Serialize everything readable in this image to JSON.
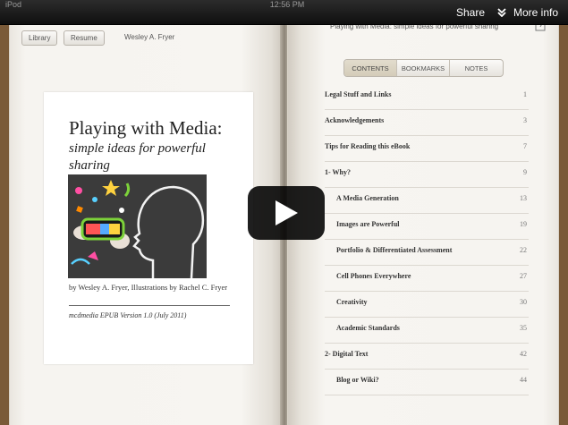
{
  "status_bar": {
    "device": "iPod",
    "time": "12:56 PM"
  },
  "player_overlay": {
    "share_label": "Share",
    "more_info_label": "More info"
  },
  "left_page": {
    "toolbar": {
      "library_label": "Library",
      "resume_label": "Resume",
      "author": "Wesley A. Fryer"
    },
    "cover": {
      "title": "Playing with Media:",
      "subtitle": "simple ideas for powerful sharing",
      "credits": "by Wesley A. Fryer, Illustrations by Rachel C. Fryer",
      "edition": "mcdmedia EPUB Version 1.0 (July 2011)"
    }
  },
  "right_page": {
    "header_title": "Playing with Media: simple ideas for powerful sharing",
    "tabs": [
      {
        "label": "CONTENTS",
        "active": true
      },
      {
        "label": "BOOKMARKS",
        "active": false
      },
      {
        "label": "NOTES",
        "active": false
      }
    ],
    "toc": [
      {
        "title": "Legal Stuff and Links",
        "page": "1",
        "level": 0
      },
      {
        "title": "Acknowledgements",
        "page": "3",
        "level": 0
      },
      {
        "title": "Tips for Reading this eBook",
        "page": "7",
        "level": 0
      },
      {
        "title": "1- Why?",
        "page": "9",
        "level": 0
      },
      {
        "title": "A Media Generation",
        "page": "13",
        "level": 1
      },
      {
        "title": "Images are Powerful",
        "page": "19",
        "level": 1
      },
      {
        "title": "Portfolio & Differentiated Assessment",
        "page": "22",
        "level": 1
      },
      {
        "title": "Cell Phones Everywhere",
        "page": "27",
        "level": 1
      },
      {
        "title": "Creativity",
        "page": "30",
        "level": 1
      },
      {
        "title": "Academic Standards",
        "page": "35",
        "level": 1
      },
      {
        "title": "2- Digital Text",
        "page": "42",
        "level": 0
      },
      {
        "title": "Blog or Wiki?",
        "page": "44",
        "level": 1
      }
    ]
  },
  "colors": {
    "play_button_bg": "#000000",
    "page_bg": "#f5f3ef",
    "book_spine": "#7a5a38"
  }
}
